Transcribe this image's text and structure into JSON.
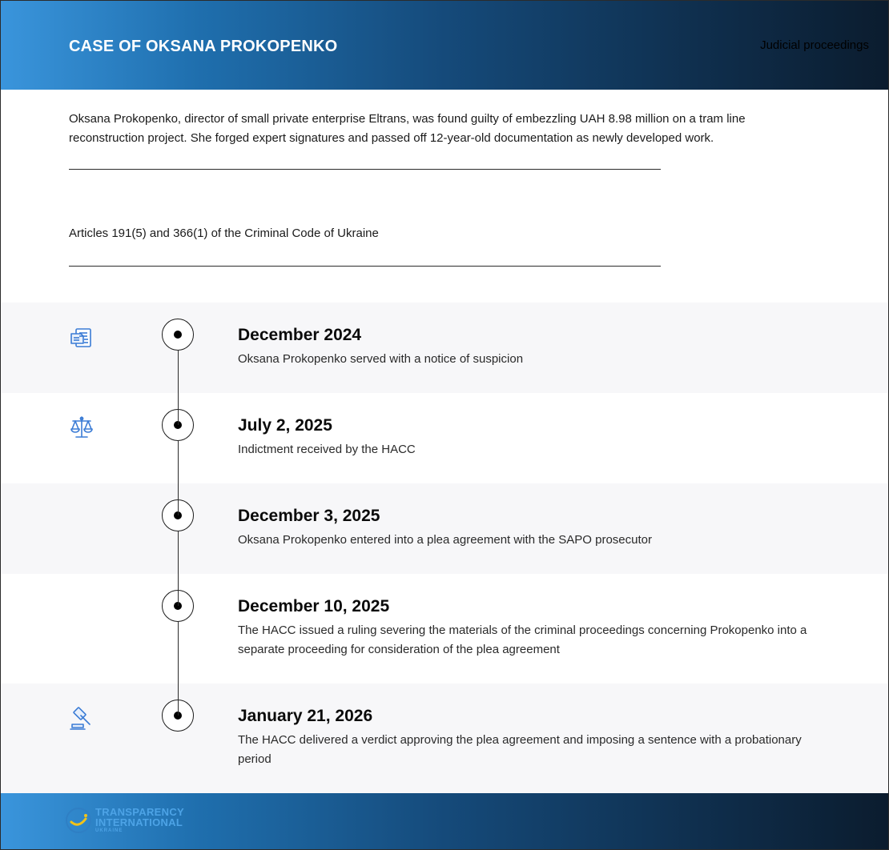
{
  "header": {
    "title": "CASE OF OKSANA PROKOPENKO",
    "tag": "Judicial proceedings"
  },
  "intro": {
    "summary": "Oksana Prokopenko, director of small private enterprise Eltrans, was found guilty of embezzling UAH 8.98 million on a tram line reconstruction project. She forged expert signatures and passed off 12-year-old documentation as newly developed work.",
    "articles": "Articles 191(5) and 366(1) of the Criminal Code of Ukraine"
  },
  "timeline": [
    {
      "date": "December 2024",
      "description": "Oksana Prokopenko served with a notice of suspicion",
      "icon": "documents-icon"
    },
    {
      "date": "July 2, 2025",
      "description": "Indictment received by the HACC",
      "icon": "scales-icon"
    },
    {
      "date": "December 3, 2025",
      "description": "Oksana Prokopenko entered into a plea agreement with the SAPO prosecutor",
      "icon": ""
    },
    {
      "date": "December 10, 2025",
      "description": "The HACC issued a ruling severing the materials of the criminal proceedings concerning Prokopenko into a separate proceeding for consideration of the plea agreement",
      "icon": ""
    },
    {
      "date": "January 21, 2026",
      "description": "The HACC delivered a verdict approving the plea agreement and imposing a sentence with a probationary period",
      "icon": "gavel-icon"
    }
  ],
  "footer": {
    "logo_line1": "TRANSPARENCY",
    "logo_line2": "INTERNATIONAL",
    "logo_line3": "UKRAINE"
  },
  "colors": {
    "accent": "#3a95dc",
    "dark": "#0b1c2e",
    "icon": "#3a7bd5"
  }
}
